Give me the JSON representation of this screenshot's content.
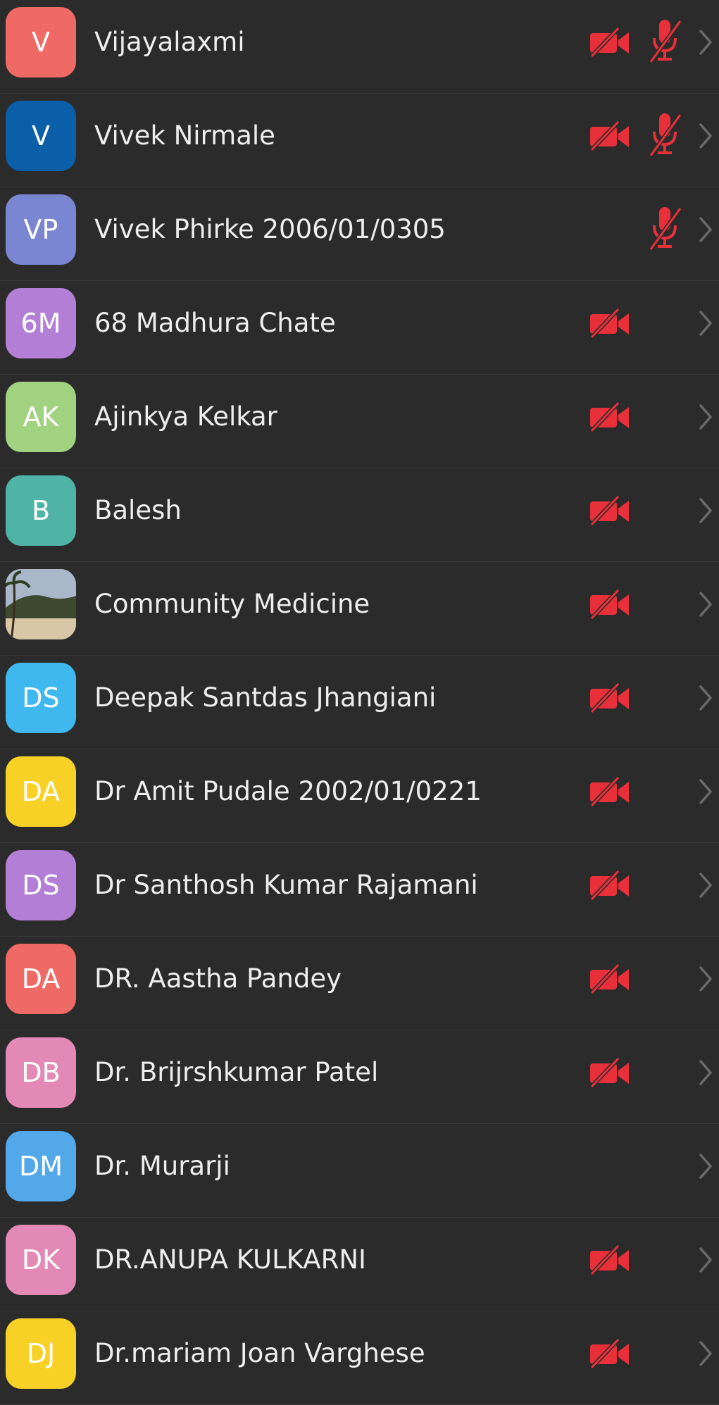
{
  "icons": {
    "video_off": "video-off-icon",
    "mic_off": "mic-off-icon",
    "chevron": "chevron-right-icon"
  },
  "colors": {
    "background": "#2b2b2b",
    "muted_red": "#e8303a",
    "chevron": "#6a6a6a",
    "name_text": "#eeeeee"
  },
  "participants": [
    {
      "initials": "V",
      "name": "Vijayalaxmi",
      "avatar_color": "#f06a65",
      "video_off": true,
      "mic_off": true
    },
    {
      "initials": "V",
      "name": "Vivek Nirmale",
      "avatar_color": "#0b5ea8",
      "video_off": true,
      "mic_off": true
    },
    {
      "initials": "VP",
      "name": "Vivek Phirke 2006/01/0305",
      "avatar_color": "#7a86d1",
      "video_off": false,
      "mic_off": true
    },
    {
      "initials": "6M",
      "name": "68 Madhura Chate",
      "avatar_color": "#b37fd6",
      "video_off": true,
      "mic_off": false
    },
    {
      "initials": "AK",
      "name": "Ajinkya Kelkar",
      "avatar_color": "#a1d27f",
      "video_off": true,
      "mic_off": false
    },
    {
      "initials": "B",
      "name": "Balesh",
      "avatar_color": "#4fb3a6",
      "video_off": true,
      "mic_off": false
    },
    {
      "initials": "",
      "name": "Community Medicine",
      "avatar_color": "",
      "photo": true,
      "video_off": true,
      "mic_off": false
    },
    {
      "initials": "DS",
      "name": "Deepak Santdas Jhangiani",
      "avatar_color": "#3fb8ef",
      "video_off": true,
      "mic_off": false
    },
    {
      "initials": "DA",
      "name": "Dr Amit Pudale 2002/01/0221",
      "avatar_color": "#f8d127",
      "video_off": true,
      "mic_off": false
    },
    {
      "initials": "DS",
      "name": "Dr Santhosh Kumar Rajamani",
      "avatar_color": "#b37fd6",
      "video_off": true,
      "mic_off": false
    },
    {
      "initials": "DA",
      "name": "DR. Aastha Pandey",
      "avatar_color": "#f06a65",
      "video_off": true,
      "mic_off": false
    },
    {
      "initials": "DB",
      "name": "Dr. Brijrshkumar Patel",
      "avatar_color": "#e389b6",
      "video_off": true,
      "mic_off": false
    },
    {
      "initials": "DM",
      "name": "Dr. Murarji",
      "avatar_color": "#53a8ea",
      "video_off": false,
      "mic_off": false
    },
    {
      "initials": "DK",
      "name": "DR.ANUPA KULKARNI",
      "avatar_color": "#e389b6",
      "video_off": true,
      "mic_off": false
    },
    {
      "initials": "DJ",
      "name": "Dr.mariam Joan Varghese",
      "avatar_color": "#f8d127",
      "video_off": true,
      "mic_off": false
    }
  ]
}
